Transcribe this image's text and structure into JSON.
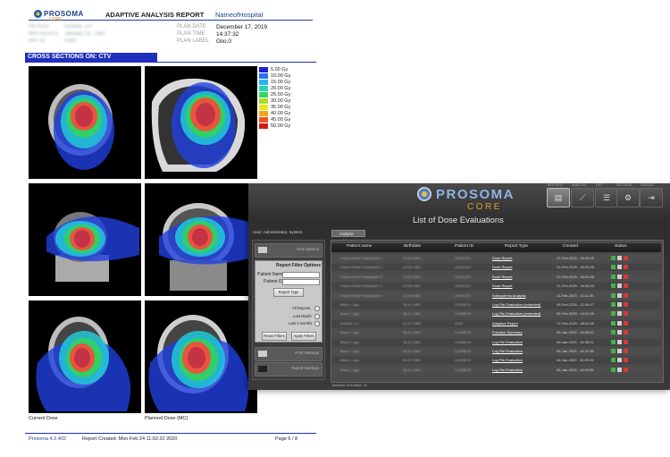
{
  "report": {
    "logo_text": "PROSOMA",
    "logo_sub": "CORE",
    "title": "ADAPTIVE ANALYSIS REPORT",
    "hospital": "NameofHospital",
    "patient_fields": [
      {
        "label": "PATIENT",
        "value": "Schultz, LH"
      },
      {
        "label": "BIRTHDATE",
        "value": "January 01, 1960"
      },
      {
        "label": "PAT ID",
        "value": "0000"
      }
    ],
    "plan_fields": [
      {
        "label": "PLAN DATE",
        "value": "December 17, 2019"
      },
      {
        "label": "PLAN TIME",
        "value": "14:37:32"
      },
      {
        "label": "PLAN LABEL",
        "value": "Glio.0"
      }
    ],
    "section_title": "CROSS SECTIONS ON: CTV",
    "legend": [
      {
        "label": "5.00 Gy",
        "color": "#1f1fd6"
      },
      {
        "label": "10.00 Gy",
        "color": "#2b6ff2"
      },
      {
        "label": "15.00 Gy",
        "color": "#25b4f0"
      },
      {
        "label": "20.00 Gy",
        "color": "#22d6b8"
      },
      {
        "label": "25.00 Gy",
        "color": "#35d45a"
      },
      {
        "label": "30.00 Gy",
        "color": "#a8e02a"
      },
      {
        "label": "35.00 Gy",
        "color": "#f0e21e"
      },
      {
        "label": "40.00 Gy",
        "color": "#f5a41c"
      },
      {
        "label": "45.00 Gy",
        "color": "#f0541b"
      },
      {
        "label": "50.00 Gy",
        "color": "#d11b1b"
      }
    ],
    "caption_left": "Current Dose",
    "caption_right": "Planned Dose (MC)",
    "footer_left": "Prosoma 4.2.402",
    "footer_mid": "Report Created: Mon Feb 24 11:02:22 2020",
    "footer_right": "Page 6 / 8"
  },
  "app": {
    "brand": "PROSOMA",
    "brand_sub": "CORE",
    "title": "List of Dose Evaluations",
    "toolbar": [
      {
        "icon": "report-icon",
        "caption": "REPORTS"
      },
      {
        "icon": "analysis-icon",
        "caption": "ANALYSIS"
      },
      {
        "icon": "list-icon",
        "caption": "LIST"
      },
      {
        "icon": "settings-icon",
        "caption": "SETTINGS"
      },
      {
        "icon": "logout-icon",
        "caption": "LOGOUT"
      }
    ],
    "user_label": "User: Administrator, System",
    "tab_label": "Analysis Tables",
    "side_top_label": "Sort Options",
    "filter": {
      "title": "Report Filter Options",
      "patient_name_label": "Patient Name",
      "patient_id_label": "Patient ID",
      "report_type_label": "Report Type",
      "radio_options": [
        "All Reports",
        "Last Month",
        "Last 3 months"
      ],
      "reset_label": "Reset Filters",
      "apply_label": "Apply Filters"
    },
    "side_bottom_1": "Print Settings",
    "side_bottom_2": "Export Settings",
    "columns": [
      "Patient name",
      "Birthdate",
      "Patient ID",
      "Report Type",
      "Created",
      "Status"
    ],
    "rows": [
      {
        "name": "Fname Mlast Testpatient 1",
        "birth": "12.06.1961",
        "pid": "10001223",
        "type": "Dose Report",
        "created": "21-Feb-2020 - 16:39:09"
      },
      {
        "name": "Fname Mlast Testpatient 2",
        "birth": "12.06.1961",
        "pid": "10001223",
        "type": "Dose Report",
        "created": "21-Feb-2020 - 16:29:25"
      },
      {
        "name": "Fname Mlast Testpatient 3",
        "birth": "12.06.1961",
        "pid": "10001223",
        "type": "Dose Report",
        "created": "21-Feb-2020 - 16:24:58"
      },
      {
        "name": "Fname Mlast Testpatient 4",
        "birth": "12.06.1961",
        "pid": "10001223",
        "type": "Dose Report",
        "created": "21-Feb-2020 - 16:40:23"
      },
      {
        "name": "Fname Mlast Testpatient 5",
        "birth": "12.06.1961",
        "pid": "10001223",
        "type": "Subsystems Analysis",
        "created": "11-Feb-2020 - 11:11:39"
      },
      {
        "name": "Mann, Legs",
        "birth": "08.11.1960",
        "pid": "12345678",
        "type": "Log File Evaluation (extended)",
        "created": "08-Feb-2020 - 12:44:17"
      },
      {
        "name": "Mann, Legs",
        "birth": "08.11.1960",
        "pid": "12345678",
        "type": "Log File Evaluation (extended)",
        "created": "08-Feb-2020 - 14:01:29"
      },
      {
        "name": "Schultz, LH",
        "birth": "01.01.1960",
        "pid": "0000",
        "type": "Adaptive Report",
        "created": "17-Feb-2020 - 08:32:09"
      },
      {
        "name": "Mann, Legs",
        "birth": "08.11.1960",
        "pid": "12345678",
        "type": "Function Summary",
        "created": "06-Jan-2020 - 16:33:42"
      },
      {
        "name": "Mann, Legs",
        "birth": "08.11.1960",
        "pid": "12345678",
        "type": "Log File Evaluation",
        "created": "06-Jan-2020 - 16:38:11"
      },
      {
        "name": "Mann, Legs",
        "birth": "08.11.1960",
        "pid": "12345678",
        "type": "Log File Evaluation",
        "created": "06-Jan-2020 - 16:21:38"
      },
      {
        "name": "Mann, Legs",
        "birth": "08.11.1960",
        "pid": "12345678",
        "type": "Log File Evaluation",
        "created": "06-Jan-2020 - 16:09:31"
      },
      {
        "name": "Mann, Legs",
        "birth": "08.11.1960",
        "pid": "12345678",
        "type": "Log File Evaluation",
        "created": "06-Jan-2020 - 16:09:56"
      }
    ],
    "footer_count": "Number of Entries: 13",
    "colors": {
      "status_green": "#3fb34a",
      "status_red": "#d23b3b"
    }
  }
}
